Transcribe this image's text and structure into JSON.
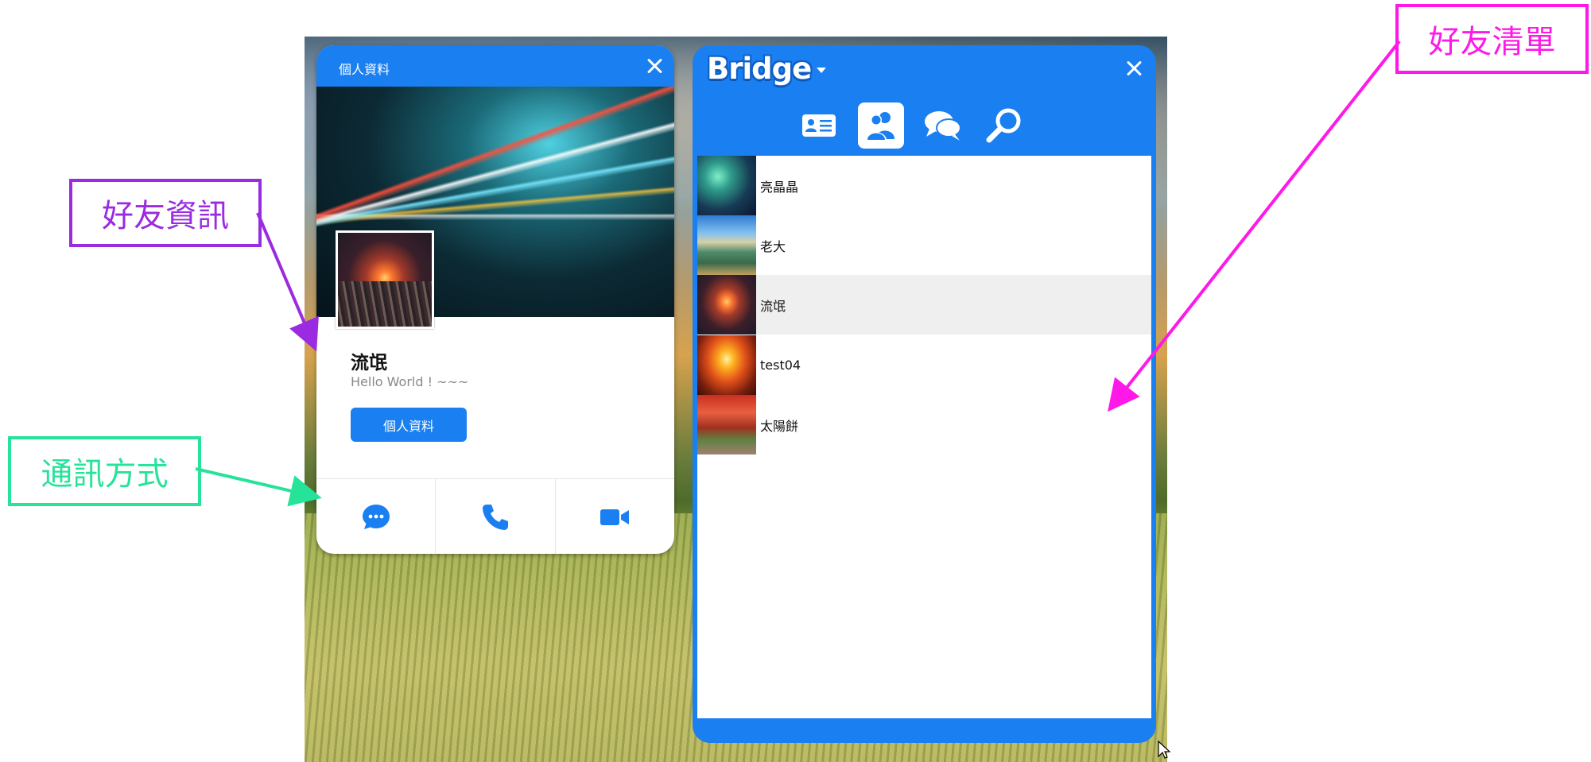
{
  "profile_window": {
    "title": "個人資料",
    "name": "流氓",
    "status": "Hello World ! ~~~",
    "profile_button_label": "個人資料",
    "comm_actions": [
      "chat-bubble-icon",
      "phone-icon",
      "video-camera-icon"
    ]
  },
  "bridge_window": {
    "logo": "Bridge",
    "tabs": [
      "contact-card-icon",
      "friends-icon",
      "chat-icon",
      "search-icon"
    ],
    "active_tab": "friends-icon",
    "friends": [
      {
        "name": "亮晶晶"
      },
      {
        "name": "老大"
      },
      {
        "name": "流氓",
        "selected": true
      },
      {
        "name": "test04"
      },
      {
        "name": "太陽餅"
      }
    ]
  },
  "annotations": {
    "friend_info": "好友資訊",
    "communication": "通訊方式",
    "friend_list": "好友清單"
  },
  "colors": {
    "window_blue": "#1a7ff0",
    "annotation_purple": "#9a2be0",
    "annotation_green": "#26e39a",
    "annotation_magenta": "#ff18e8"
  }
}
